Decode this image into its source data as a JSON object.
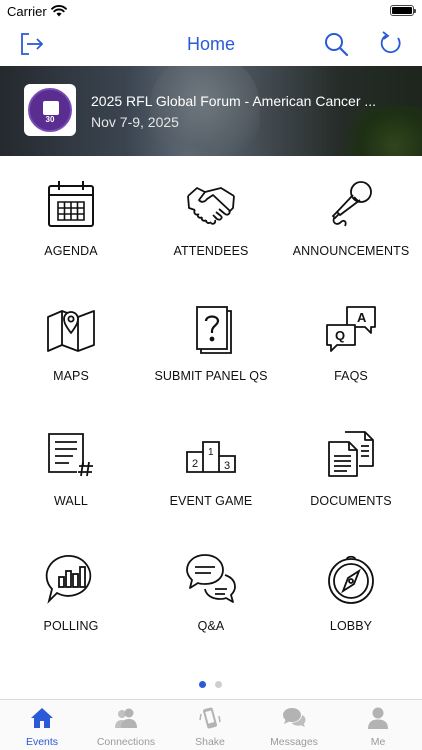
{
  "status_bar": {
    "carrier": "Carrier"
  },
  "nav": {
    "title": "Home"
  },
  "banner": {
    "event_title": "2025 RFL Global Forum - American Cancer ...",
    "event_dates": "Nov 7-9, 2025",
    "logo_text": "THIRTY YEAR ANNIVERSARY 30"
  },
  "tiles": [
    {
      "label": "AGENDA",
      "icon": "calendar-icon"
    },
    {
      "label": "ATTENDEES",
      "icon": "handshake-icon"
    },
    {
      "label": "ANNOUNCEMENTS",
      "icon": "microphone-icon"
    },
    {
      "label": "MAPS",
      "icon": "map-pin-icon"
    },
    {
      "label": "SUBMIT PANEL QS",
      "icon": "question-card-icon"
    },
    {
      "label": "FAQS",
      "icon": "qa-bubbles-icon"
    },
    {
      "label": "WALL",
      "icon": "wall-post-icon"
    },
    {
      "label": "EVENT GAME",
      "icon": "podium-icon"
    },
    {
      "label": "DOCUMENTS",
      "icon": "documents-icon"
    },
    {
      "label": "POLLING",
      "icon": "poll-chart-icon"
    },
    {
      "label": "Q&A",
      "icon": "chat-bubbles-icon"
    },
    {
      "label": "LOBBY",
      "icon": "compass-icon"
    }
  ],
  "pager": {
    "pages": 2,
    "current": 1
  },
  "tabs": [
    {
      "label": "Events",
      "icon": "home-icon",
      "active": true
    },
    {
      "label": "Connections",
      "icon": "people-icon",
      "active": false
    },
    {
      "label": "Shake",
      "icon": "shake-phone-icon",
      "active": false
    },
    {
      "label": "Messages",
      "icon": "messages-icon",
      "active": false
    },
    {
      "label": "Me",
      "icon": "person-icon",
      "active": false
    }
  ],
  "colors": {
    "accent": "#2a5ad8",
    "tab_inactive": "#9a9a9a",
    "logo_purple": "#5a2d91"
  }
}
